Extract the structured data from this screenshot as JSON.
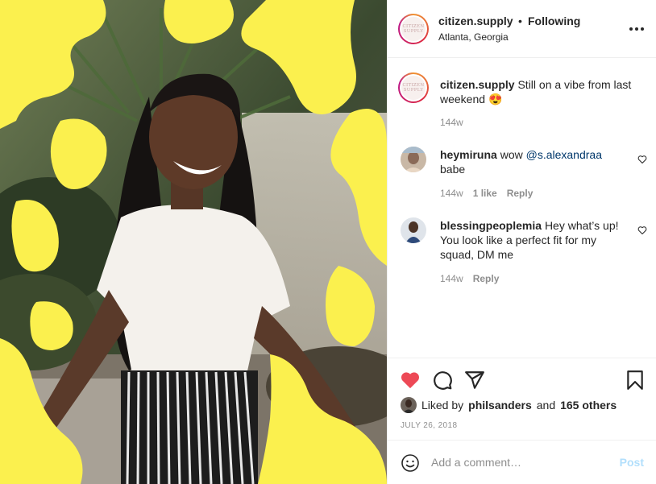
{
  "post": {
    "image": {
      "description": "woman with long braids in white t-shirt smiling, yellow blob overlay"
    },
    "header": {
      "username": "citizen.supply",
      "separator": "•",
      "follow_status": "Following",
      "location": "Atlanta, Georgia",
      "avatar_text": "CITIZEN SUPPLY"
    },
    "caption": {
      "username": "citizen.supply",
      "text": "Still on a vibe from last weekend",
      "emoji": "😍",
      "time": "144w"
    },
    "comments": [
      {
        "username": "heymiruna",
        "text_pre": "wow ",
        "mention": "@s.alexandraa",
        "text_post": " babe",
        "time": "144w",
        "likes": "1 like",
        "reply": "Reply"
      },
      {
        "username": "blessingpeoplemia",
        "text": "Hey what’s up! You look like a perfect fit for my squad, DM me",
        "time": "144w",
        "reply": "Reply"
      }
    ],
    "likes": {
      "prefix": "Liked by",
      "liker": "philsanders",
      "middle": "and",
      "others": "165 others"
    },
    "date": "JULY 26, 2018",
    "add_comment": {
      "placeholder": "Add a comment…",
      "post_label": "Post"
    },
    "colors": {
      "like_red": "#ed4956",
      "blob_yellow": "#fbf04e",
      "post_blue": "#b2dffc"
    }
  }
}
